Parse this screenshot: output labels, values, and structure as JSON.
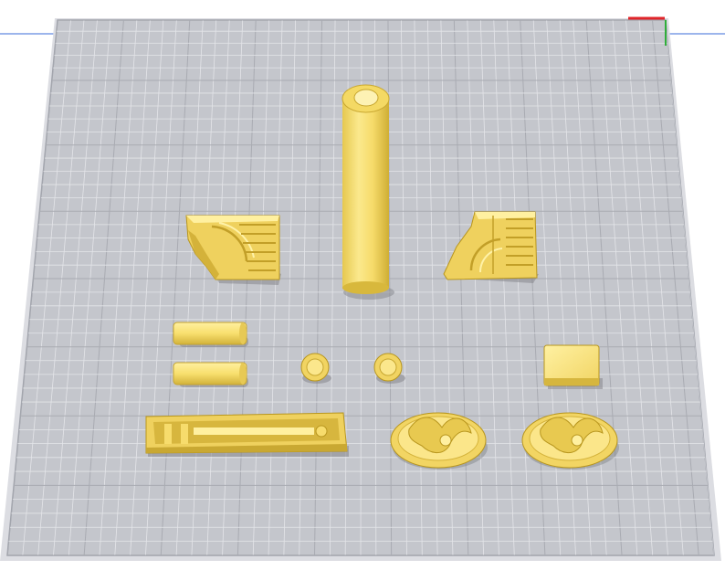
{
  "app": {
    "view": "prepare",
    "camera": "perspective"
  },
  "colors": {
    "background": "#ffffff",
    "bed_surface": "#c4c6cc",
    "bed_grid_minor": "#e4e5e9",
    "bed_grid_major": "#a9abb2",
    "bed_border": "#9fa2aa",
    "disallowed_edge": "#d9dadf",
    "axis_x": "#e0242a",
    "axis_y": "#3a6bd8",
    "axis_z": "#2fae3a",
    "model_fill": "#f9e27a",
    "model_light": "#fff3a8",
    "model_shade": "#d9b93c",
    "model_dark": "#b8961e",
    "model_shadow": "#6f6f74"
  },
  "models": [
    {
      "id": "tube",
      "shape": "tube"
    },
    {
      "id": "shroud-left",
      "shape": "shroud"
    },
    {
      "id": "shroud-right",
      "shape": "shroud"
    },
    {
      "id": "pin-1",
      "shape": "cylinder"
    },
    {
      "id": "pin-2",
      "shape": "cylinder"
    },
    {
      "id": "knob-1",
      "shape": "gear"
    },
    {
      "id": "knob-2",
      "shape": "gear"
    },
    {
      "id": "block",
      "shape": "cube"
    },
    {
      "id": "rail",
      "shape": "rail"
    },
    {
      "id": "emblem-1",
      "shape": "oval-badge"
    },
    {
      "id": "emblem-2",
      "shape": "oval-badge"
    }
  ]
}
